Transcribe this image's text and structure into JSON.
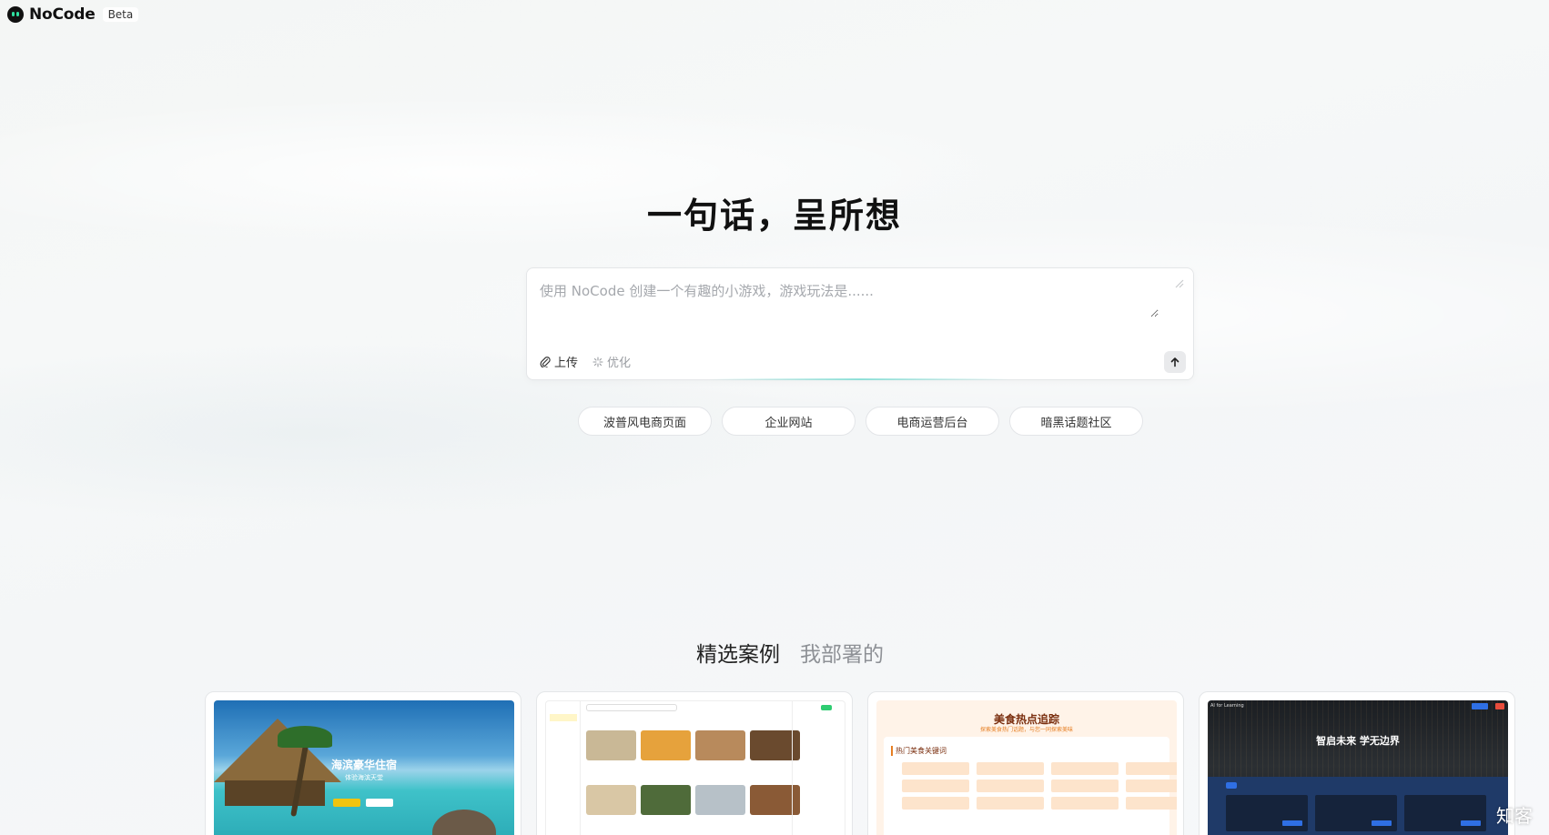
{
  "header": {
    "brand": "NoCode",
    "badge": "Beta"
  },
  "hero": {
    "title": "一句话，呈所想"
  },
  "prompt": {
    "placeholder": "使用 NoCode 创建一个有趣的小游戏，游戏玩法是......",
    "value": "",
    "upload_label": "上传",
    "optimize_label": "优化",
    "icons": {
      "upload": "paperclip-icon",
      "optimize": "sparkle-icon",
      "send": "arrow-up-icon",
      "resize": "resize-handle-icon"
    }
  },
  "suggestions": [
    "波普风电商页面",
    "企业网站",
    "电商运营后台",
    "暗黑话题社区"
  ],
  "tabs": [
    {
      "label": "精选案例",
      "active": true
    },
    {
      "label": "我部署的",
      "active": false
    }
  ],
  "cases": [
    {
      "title": "海滨豪华住宿",
      "subtitle": "体验海滨天堂"
    },
    {
      "title": ""
    },
    {
      "title": "美食热点追踪",
      "subtitle": "探索美食热门话题，与您一同探索美味",
      "section": "热门美食关键词"
    },
    {
      "title": "智启未来 学无边界",
      "topbar": "AI for Learning"
    }
  ],
  "watermark": "知客",
  "colors": {
    "accent_teal": "#2fe0a0",
    "text_primary": "#111111",
    "text_muted": "#8e9196"
  }
}
